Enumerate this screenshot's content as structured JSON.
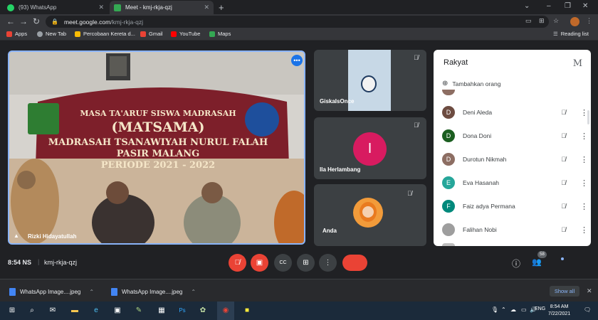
{
  "tabs": [
    {
      "title": "(93) WhatsApp",
      "favicon_color": "#25d366"
    },
    {
      "title": "Meet - kmj-rkja-qzj",
      "favicon_color": "#34a853"
    }
  ],
  "address_bar": {
    "domain": "meet.google.com",
    "path": "/kmj-rkja-qzj"
  },
  "bookmarks": [
    {
      "label": "Apps",
      "icon_color": "#ea4335"
    },
    {
      "label": "New Tab",
      "icon_color": "#9aa0a6"
    },
    {
      "label": "Percobaan Kereta d...",
      "icon_color": "#fbbc05"
    },
    {
      "label": "Gmail",
      "icon_color": "#ea4335"
    },
    {
      "label": "YouTube",
      "icon_color": "#ff0000"
    },
    {
      "label": "Maps",
      "icon_color": "#34a853"
    }
  ],
  "reading_list": "Reading list",
  "main_video": {
    "participant": "Rizki Hidayatullah",
    "banner": {
      "line1": "MASA TA'ARUF SISWA MADRASAH",
      "line2": "(MATSAMA)",
      "line3": "MADRASAH TSANAWIYAH NURUL FALAH",
      "line4": "PASIR MALANG",
      "line5": "PERIODE 2021 - 2022"
    }
  },
  "tiles": [
    {
      "name": "GiskaIsOnce",
      "type": "video"
    },
    {
      "name": "Ila Herlambang",
      "type": "avatar",
      "initial": "I",
      "color": "#d81b60"
    },
    {
      "name": "Anda",
      "type": "video"
    }
  ],
  "people_panel": {
    "title": "Rakyat",
    "add_people": "Tambahkan orang",
    "participants": [
      {
        "name": "Deni Aleda",
        "initial": "D",
        "color": "#6d4c41"
      },
      {
        "name": "Dona Doni",
        "initial": "D",
        "color": "#1b5e20"
      },
      {
        "name": "Durotun Nikmah",
        "initial": "D",
        "color": "#8d6e63"
      },
      {
        "name": "Eva Hasanah",
        "initial": "E",
        "color": "#26a69a"
      },
      {
        "name": "Faiz adya Permana",
        "initial": "F",
        "color": "#00897b"
      },
      {
        "name": "Falihan Nobi",
        "initial": "",
        "color": "#9e9e9e"
      }
    ]
  },
  "meeting": {
    "time": "8:54 NS",
    "code": "kmj-rkja-qzj",
    "participant_count": "58"
  },
  "downloads": [
    {
      "name": "WhatsApp Image....jpeg"
    },
    {
      "name": "WhatsApp Image....jpeg"
    }
  ],
  "show_all": "Show all",
  "taskbar": {
    "time": "8:54 AM",
    "date": "7/22/2021",
    "lang": "ENG"
  }
}
